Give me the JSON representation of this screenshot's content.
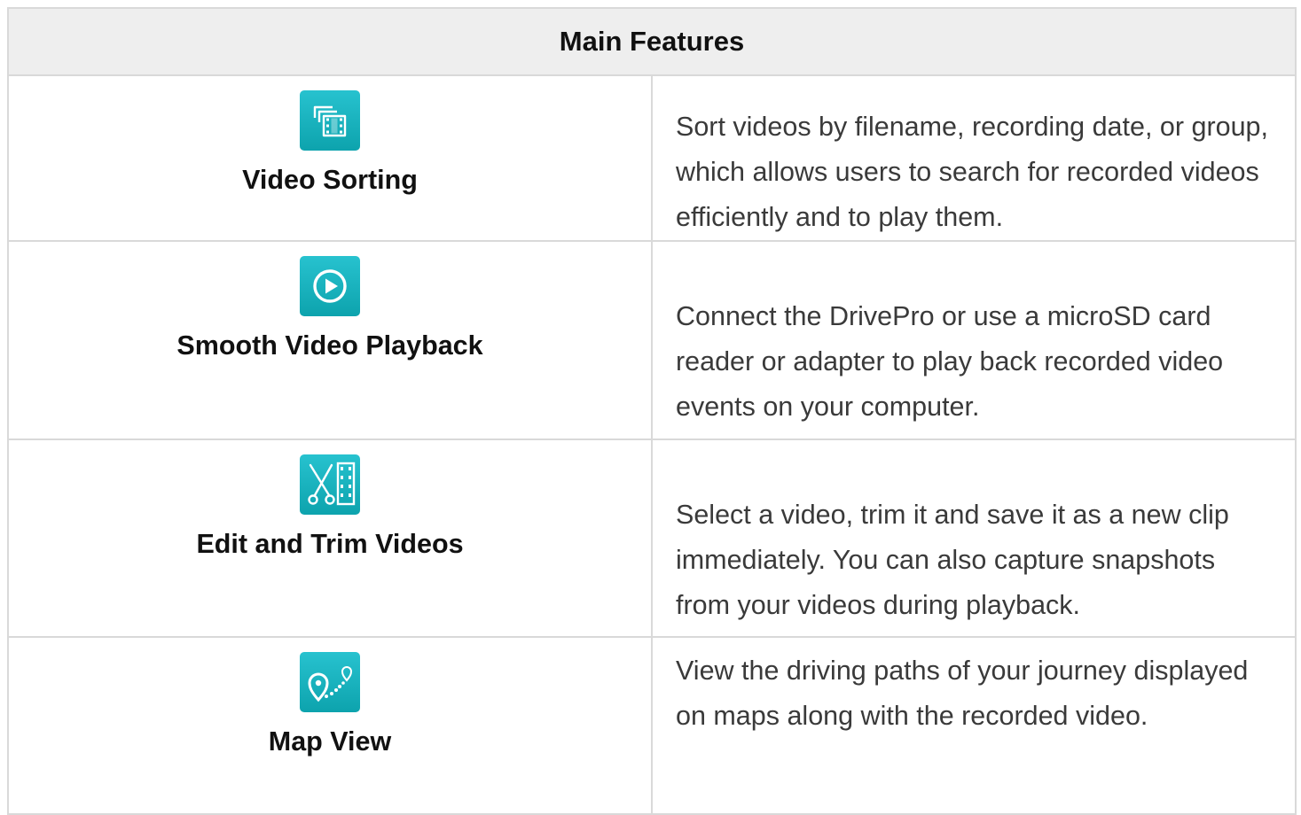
{
  "table": {
    "header": "Main Features",
    "rows": [
      {
        "name": "Video Sorting",
        "icon": "video-sorting-icon",
        "description": "Sort videos by filename, recording date, or group, which allows users to search for recorded videos efficiently and to play them."
      },
      {
        "name": "Smooth Video Playback",
        "icon": "play-circle-icon",
        "description": "Connect the DrivePro or use a microSD card reader or adapter to play back recorded video events on your computer."
      },
      {
        "name": "Edit and Trim Videos",
        "icon": "scissors-film-icon",
        "description": "Select a video, trim it and save it as a new clip immediately. You can also capture snapshots from your videos during playback."
      },
      {
        "name": "Map View",
        "icon": "map-route-icon",
        "description": "View the driving paths of your journey displayed on maps along with the recorded video."
      }
    ]
  },
  "colors": {
    "icon_gradient_top": "#27c2cf",
    "icon_gradient_bottom": "#0da3ad",
    "header_background": "#eeeeee",
    "border": "#d9d9d9"
  }
}
